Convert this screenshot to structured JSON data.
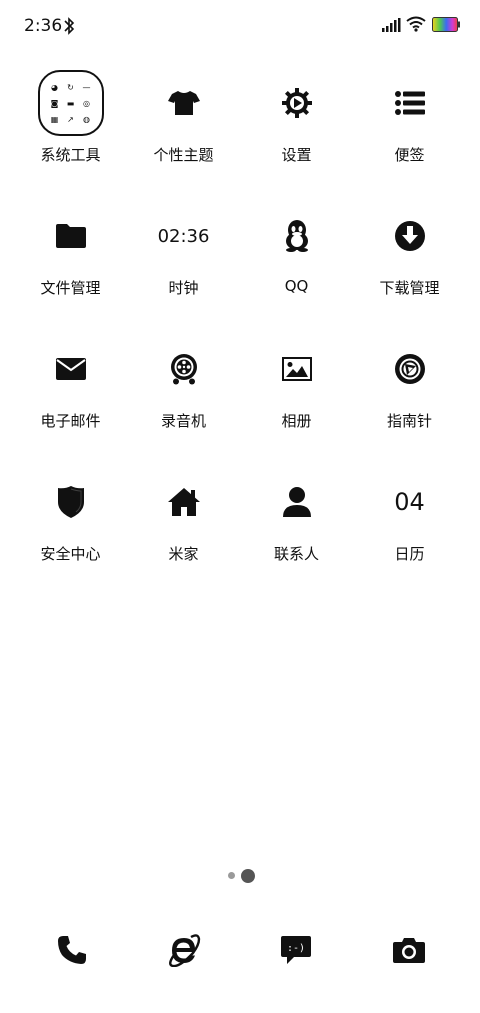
{
  "status_bar": {
    "time": "2:36"
  },
  "apps": [
    {
      "name": "app-system-tools",
      "label": "系统工具",
      "icon": "folder-icon"
    },
    {
      "name": "app-themes",
      "label": "个性主题",
      "icon": "tshirt-icon"
    },
    {
      "name": "app-settings",
      "label": "设置",
      "icon": "gear-icon"
    },
    {
      "name": "app-notes",
      "label": "便签",
      "icon": "list-icon"
    },
    {
      "name": "app-file-manager",
      "label": "文件管理",
      "icon": "folder-file-icon"
    },
    {
      "name": "app-clock",
      "label": "时钟",
      "icon": "clock-text",
      "icon_text": "02:36"
    },
    {
      "name": "app-qq",
      "label": "QQ",
      "icon": "penguin-icon"
    },
    {
      "name": "app-downloads",
      "label": "下载管理",
      "icon": "download-icon"
    },
    {
      "name": "app-email",
      "label": "电子邮件",
      "icon": "mail-icon"
    },
    {
      "name": "app-recorder",
      "label": "录音机",
      "icon": "recorder-icon"
    },
    {
      "name": "app-gallery",
      "label": "相册",
      "icon": "image-icon"
    },
    {
      "name": "app-compass",
      "label": "指南针",
      "icon": "compass-icon"
    },
    {
      "name": "app-security",
      "label": "安全中心",
      "icon": "shield-icon"
    },
    {
      "name": "app-mihome",
      "label": "米家",
      "icon": "home-icon"
    },
    {
      "name": "app-contacts",
      "label": "联系人",
      "icon": "person-icon"
    },
    {
      "name": "app-calendar",
      "label": "日历",
      "icon": "calendar-text",
      "icon_text": "04"
    }
  ],
  "page_indicator": {
    "pages": 2,
    "current": 2
  },
  "dock": [
    {
      "name": "dock-phone",
      "icon": "phone-icon"
    },
    {
      "name": "dock-browser",
      "icon": "browser-icon"
    },
    {
      "name": "dock-messages",
      "icon": "message-icon",
      "icon_text": ":-)"
    },
    {
      "name": "dock-camera",
      "icon": "camera-icon"
    }
  ]
}
